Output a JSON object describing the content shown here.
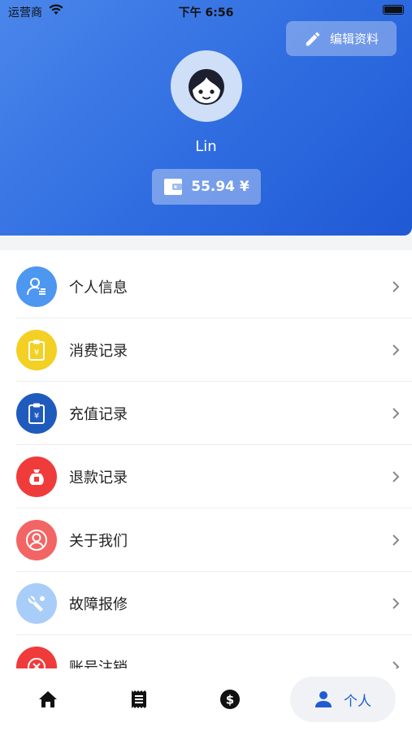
{
  "status_bar": {
    "carrier": "运营商",
    "time": "下午 6:56"
  },
  "header": {
    "edit_label": "编辑资料",
    "username": "Lin",
    "balance": "55.94 ¥"
  },
  "menu": [
    {
      "label": "个人信息",
      "icon": "profile-icon",
      "color": "#4d97f0"
    },
    {
      "label": "消费记录",
      "icon": "receipt-icon",
      "color": "#f3d023"
    },
    {
      "label": "充值记录",
      "icon": "recharge-icon",
      "color": "#1f5bbd"
    },
    {
      "label": "退款记录",
      "icon": "money-bag-icon",
      "color": "#f03b3b"
    },
    {
      "label": "关于我们",
      "icon": "user-circle-icon",
      "color": "#f36565"
    },
    {
      "label": "故障报修",
      "icon": "wrench-icon",
      "color": "#a9cdf9"
    },
    {
      "label": "账号注销",
      "icon": "cancel-icon",
      "color": "#f03b3b"
    }
  ],
  "tabs": {
    "home": "home-icon",
    "orders": "receipt-icon",
    "wallet": "dollar-icon",
    "profile_label": "个人"
  },
  "colors": {
    "primary": "#2f6ce0",
    "accent": "#1f5bd2"
  }
}
